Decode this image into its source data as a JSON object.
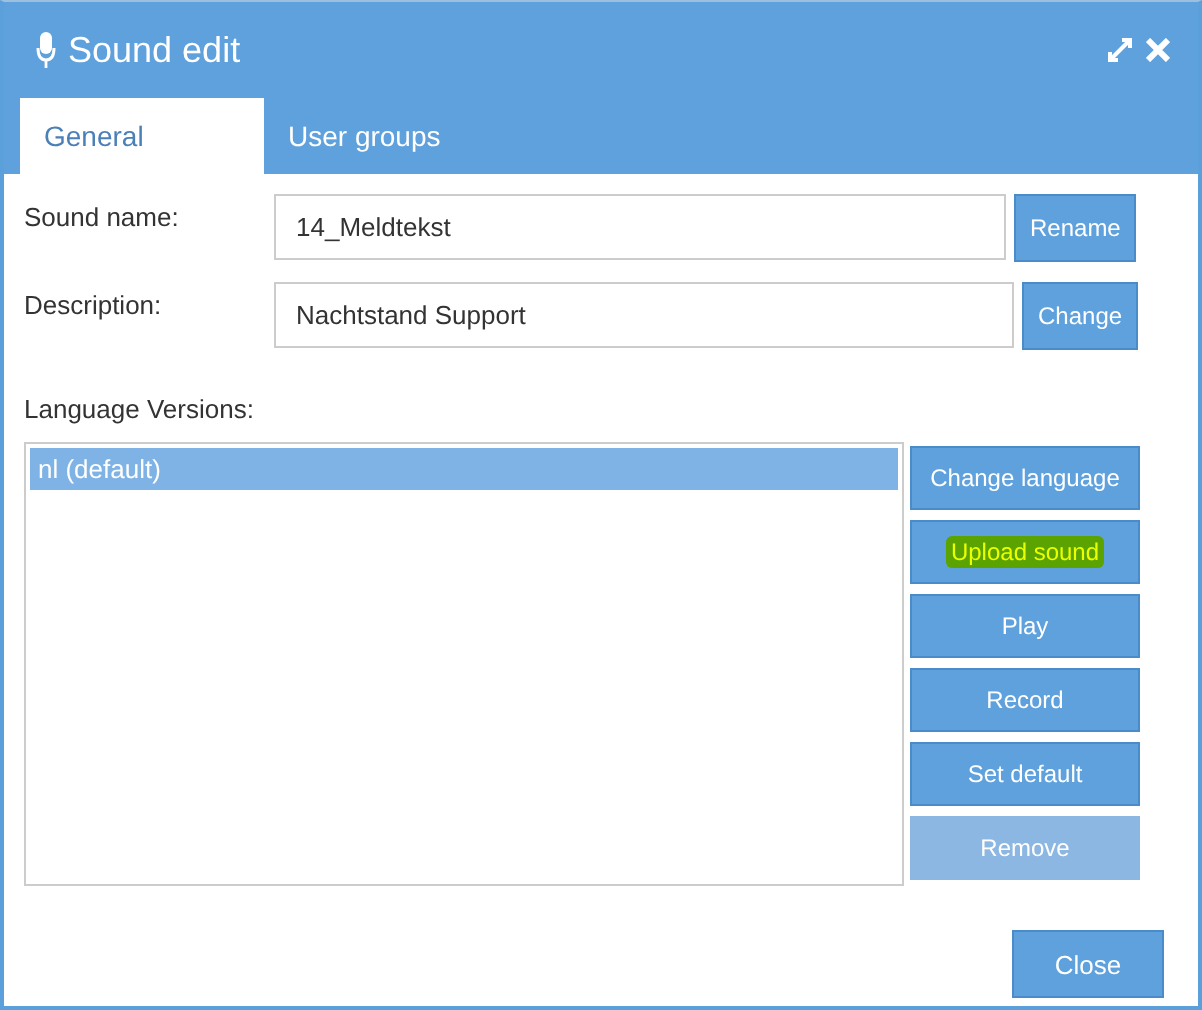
{
  "window": {
    "title": "Sound edit"
  },
  "tabs": [
    {
      "label": "General",
      "selected": true
    },
    {
      "label": "User groups",
      "selected": false
    }
  ],
  "fields": [
    {
      "label": "Sound name:",
      "value": "14_Meldtekst",
      "button": "Rename"
    },
    {
      "label": "Description:",
      "value": "Nachtstand Support",
      "button": "Change"
    }
  ],
  "language_versions": {
    "label": "Language Versions:",
    "items": [
      {
        "label": "nl (default)",
        "selected": true
      }
    ]
  },
  "actions": [
    {
      "label": "Change language",
      "disabled": false,
      "highlighted": false
    },
    {
      "label": "Upload sound",
      "disabled": false,
      "highlighted": true
    },
    {
      "label": "Play",
      "disabled": false,
      "highlighted": false
    },
    {
      "label": "Record",
      "disabled": false,
      "highlighted": false
    },
    {
      "label": "Set default",
      "disabled": false,
      "highlighted": false
    },
    {
      "label": "Remove",
      "disabled": true,
      "highlighted": false
    }
  ],
  "footer": {
    "button": "Close"
  }
}
